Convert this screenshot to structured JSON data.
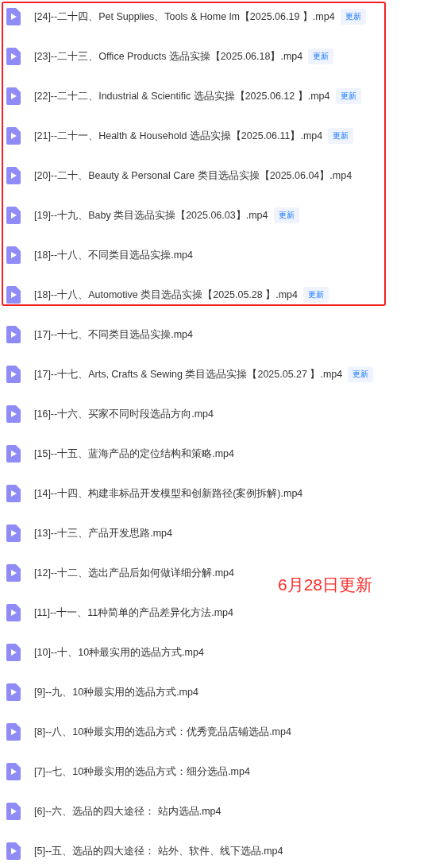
{
  "highlighted_files": [
    {
      "name": "[24]--二十四、Pet Supplies、Tools & Home lm【2025.06.19 】.mp4",
      "badge": "更新"
    },
    {
      "name": "[23]--二十三、Office Products 选品实操【2025.06.18】.mp4",
      "badge": "更新"
    },
    {
      "name": "[22]--二十二、Industrial & Scientific 选品实操【2025.06.12 】.mp4",
      "badge": "更新"
    },
    {
      "name": "[21]--二十一、Health & Household 选品实操【2025.06.11】.mp4",
      "badge": "更新"
    },
    {
      "name": "[20]--二十、Beauty & Personal Care 类目选品实操【2025.06.04】.mp4"
    },
    {
      "name": "[19]--十九、Baby 类目选品实操【2025.06.03】.mp4",
      "badge": "更新"
    },
    {
      "name": "[18]--十八、不同类目选品实操.mp4"
    },
    {
      "name": "[18]--十八、Automotive 类目选品实操【2025.05.28 】.mp4",
      "badge": "更新"
    }
  ],
  "files": [
    {
      "name": "[17]--十七、不同类目选品实操.mp4"
    },
    {
      "name": "[17]--十七、Arts, Crafts & Sewing 类目选品实操【2025.05.27 】.mp4",
      "badge": "更新"
    },
    {
      "name": "[16]--十六、买家不同时段选品方向.mp4"
    },
    {
      "name": "[15]--十五、蓝海产品的定位结构和策略.mp4"
    },
    {
      "name": "[14]--十四、构建非标品开发模型和创新路径(案例拆解).mp4"
    },
    {
      "name": "[13]--十三、产品开发思路.mp4"
    },
    {
      "name": "[12]--十二、选出产品后如何做详细分解.mp4"
    },
    {
      "name": "[11]--十一、11种简单的产品差异化方法.mp4"
    },
    {
      "name": "[10]--十、10种最实用的选品方式.mp4"
    },
    {
      "name": "[9]--九、10种最实用的选品方式.mp4"
    },
    {
      "name": "[8]--八、10种最实用的选品方式：优秀竞品店铺选品.mp4"
    },
    {
      "name": "[7]--七、10种最实用的选品方式：细分选品.mp4"
    },
    {
      "name": "[6]--六、选品的四大途径： 站内选品.mp4"
    },
    {
      "name": "[5]--五、选品的四大途径： 站外、软件、线下选品.mp4"
    }
  ],
  "annotation": "6月28日更新"
}
